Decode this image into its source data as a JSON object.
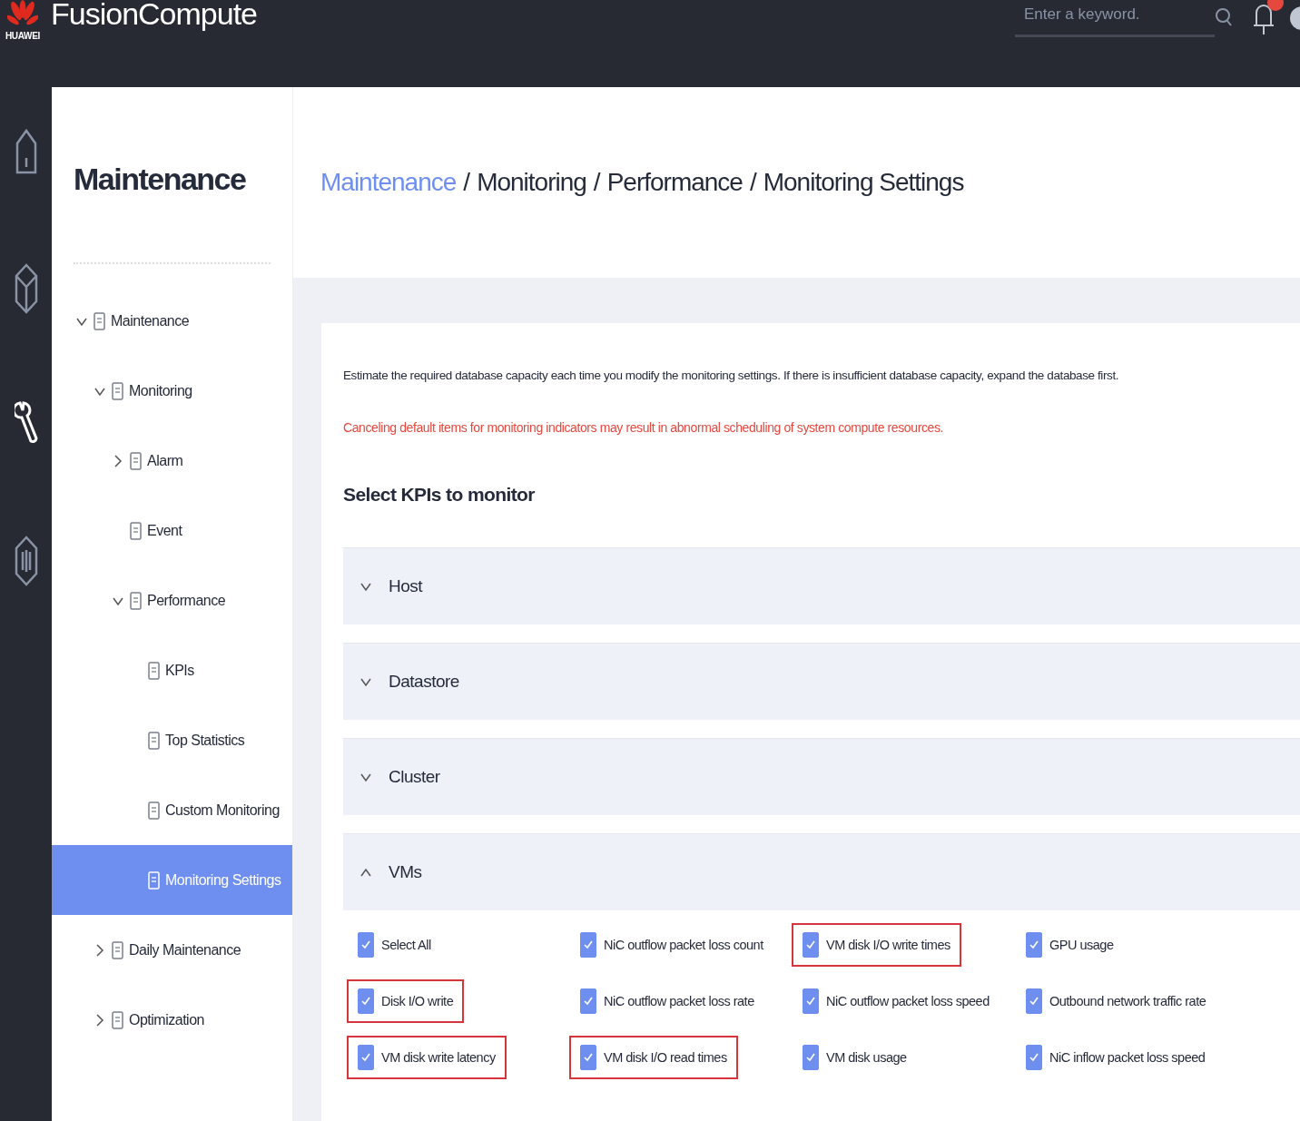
{
  "top_bar": {
    "brand": "HUAWEI",
    "title": "FusionCompute",
    "search": {
      "placeholder": "Enter a keyword."
    }
  },
  "rail": {
    "items": [
      {
        "selected": false
      },
      {
        "selected": false
      },
      {
        "selected": true
      },
      {
        "selected": false
      }
    ]
  },
  "sidebar": {
    "title": "Maintenance",
    "tree": [
      {
        "label": "Maintenance",
        "expanded": true,
        "selected": false,
        "children": [
          {
            "label": "Monitoring",
            "expanded": true,
            "selected": false,
            "children": [
              {
                "label": "Alarm",
                "expanded": false,
                "selected": false
              },
              {
                "label": "Event",
                "selected": false
              },
              {
                "label": "Performance",
                "expanded": true,
                "selected": false,
                "children": [
                  {
                    "label": "KPIs",
                    "selected": false
                  },
                  {
                    "label": "Top Statistics",
                    "selected": false
                  },
                  {
                    "label": "Custom Monitoring",
                    "selected": false
                  },
                  {
                    "label": "Monitoring Settings",
                    "selected": true
                  }
                ]
              }
            ]
          },
          {
            "label": "Daily Maintenance",
            "expanded": false,
            "selected": false
          },
          {
            "label": "Optimization",
            "expanded": false,
            "selected": false
          }
        ]
      }
    ]
  },
  "breadcrumb": {
    "separator": "/",
    "items": [
      {
        "label": "Maintenance",
        "link": true
      },
      {
        "label": "Monitoring",
        "link": false
      },
      {
        "label": "Performance",
        "link": false
      },
      {
        "label": "Monitoring Settings",
        "link": false
      }
    ]
  },
  "notice": "Estimate the required database capacity each time you modify the monitoring settings. If there is insufficient database capacity, expand the database first.",
  "warning": "Canceling default items for monitoring indicators may result in abnormal scheduling of system compute resources.",
  "section_title": "Select KPIs to monitor",
  "groups": [
    {
      "label": "Host",
      "expanded": false
    },
    {
      "label": "Datastore",
      "expanded": false
    },
    {
      "label": "Cluster",
      "expanded": false
    },
    {
      "label": "VMs",
      "expanded": true
    }
  ],
  "kpis": [
    {
      "label": "Select All",
      "checked": true,
      "highlighted": false
    },
    {
      "label": "NiC outflow packet loss count",
      "checked": true,
      "highlighted": false
    },
    {
      "label": "VM disk I/O write times",
      "checked": true,
      "highlighted": true
    },
    {
      "label": "GPU usage",
      "checked": true,
      "highlighted": false
    },
    {
      "label": "Disk I/O write",
      "checked": true,
      "highlighted": true
    },
    {
      "label": "NiC outflow packet loss rate",
      "checked": true,
      "highlighted": false
    },
    {
      "label": "NiC outflow packet loss speed",
      "checked": true,
      "highlighted": false
    },
    {
      "label": "Outbound network traffic rate",
      "checked": true,
      "highlighted": false
    },
    {
      "label": "VM disk write latency",
      "checked": true,
      "highlighted": true
    },
    {
      "label": "VM disk I/O read times",
      "checked": true,
      "highlighted": true
    },
    {
      "label": "VM disk usage",
      "checked": true,
      "highlighted": false
    },
    {
      "label": "NiC inflow packet loss speed",
      "checked": true,
      "highlighted": false
    }
  ]
}
